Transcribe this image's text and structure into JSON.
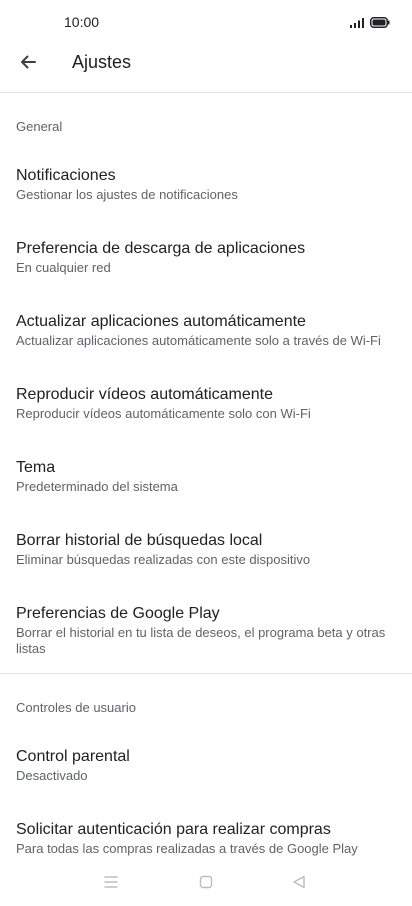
{
  "status_bar": {
    "time": "10:00"
  },
  "app_bar": {
    "title": "Ajustes"
  },
  "sections": [
    {
      "header": "General",
      "items": [
        {
          "title": "Notificaciones",
          "subtitle": "Gestionar los ajustes de notificaciones"
        },
        {
          "title": "Preferencia de descarga de aplicaciones",
          "subtitle": "En cualquier red"
        },
        {
          "title": "Actualizar aplicaciones automáticamente",
          "subtitle": "Actualizar aplicaciones automáticamente solo a través de Wi-Fi"
        },
        {
          "title": "Reproducir vídeos automáticamente",
          "subtitle": "Reproducir vídeos automáticamente solo con Wi-Fi"
        },
        {
          "title": "Tema",
          "subtitle": "Predeterminado del sistema"
        },
        {
          "title": "Borrar historial de búsquedas local",
          "subtitle": "Eliminar búsquedas realizadas con este dispositivo"
        },
        {
          "title": "Preferencias de Google Play",
          "subtitle": "Borrar el historial en tu lista de deseos, el programa beta y otras listas"
        }
      ]
    },
    {
      "header": "Controles de usuario",
      "items": [
        {
          "title": "Control parental",
          "subtitle": "Desactivado"
        },
        {
          "title": "Solicitar autenticación para realizar compras",
          "subtitle": "Para todas las compras realizadas a través de Google Play"
        }
      ]
    }
  ],
  "icons": {
    "back": "arrow-back-icon",
    "signal": "signal-icon",
    "battery": "battery-icon",
    "nav_menu": "menu-icon",
    "nav_home": "home-icon",
    "nav_back": "triangle-back-icon"
  }
}
